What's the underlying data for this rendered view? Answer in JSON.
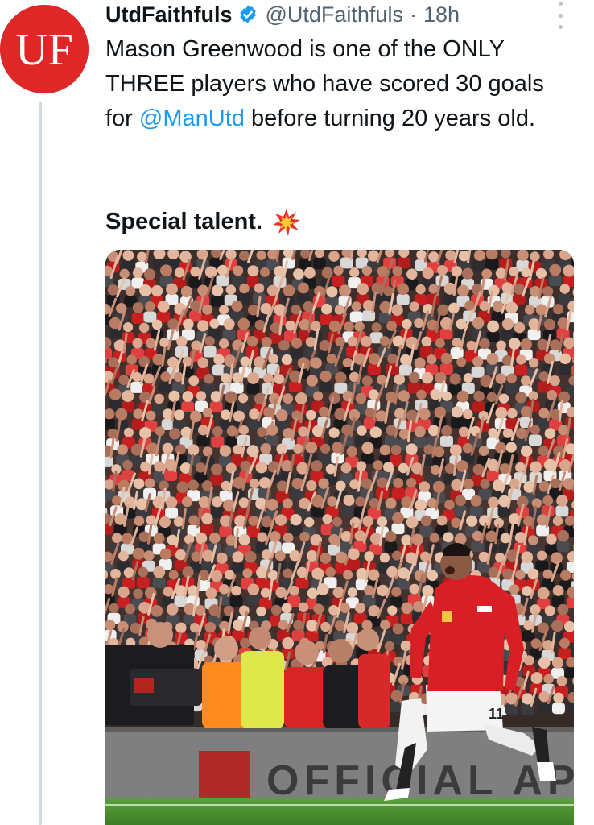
{
  "author": {
    "display_name": "UtdFaithfuls",
    "handle": "@UtdFaithfuls",
    "separator": "·",
    "time": "18h",
    "avatar_text": "UF",
    "avatar_color": "#e02424",
    "verified": true
  },
  "tweet": {
    "text_before_mention": "Mason Greenwood is one of the ONLY THREE players who have scored 30 goals for ",
    "mention": "@ManUtd",
    "text_after_mention": " before turning 20 years old.",
    "emphasis": "Special talent.",
    "emoji": "collision-icon"
  },
  "media": {
    "type": "photo",
    "board_text": "OFFICIAL APP",
    "shirt_number": "11"
  },
  "colors": {
    "link": "#1d9bf0",
    "secondary_text": "#536471",
    "thread_line": "#cfd9de",
    "verified_badge": "#1d9bf0"
  }
}
